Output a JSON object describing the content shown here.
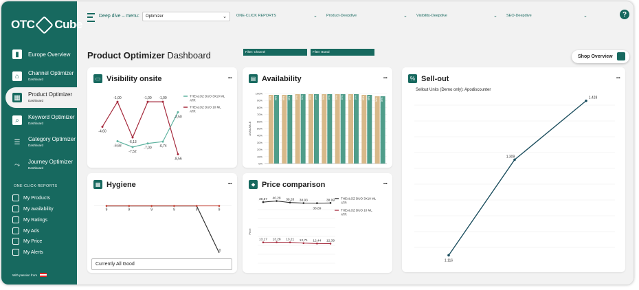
{
  "logo": {
    "left": "OTC",
    "right": "Cube"
  },
  "nav": [
    {
      "label": "Europe Overview",
      "sub": ""
    },
    {
      "label": "Channel Optimizer",
      "sub": "Dashboard"
    },
    {
      "label": "Product Optimizer",
      "sub": "Dashboard"
    },
    {
      "label": "Keyword Optimizer",
      "sub": "Dashboard"
    },
    {
      "label": "Category Optimizer",
      "sub": "Dashboard"
    },
    {
      "label": "Journey Optimizer",
      "sub": "Dashboard"
    }
  ],
  "reports_title": "ONE-CLICK-REPORTS",
  "reports": [
    "My Products",
    "My availability",
    "My Ratings",
    "My Ads",
    "My Price",
    "My Alerts"
  ],
  "footer": "With passion from",
  "topbar": {
    "deep_dive_label": "Deep dive – menu:",
    "selected": "Optimizer",
    "tabs": [
      "ONE-CLICK REPORTS",
      "Product-Deepdive",
      "Visibility-Deepdive",
      "SEO-Deepdive"
    ]
  },
  "page": {
    "title_bold": "Product Optimizer",
    "title_rest": "Dashboard",
    "filters": [
      "Filter: Channel",
      "Filter: Brand"
    ],
    "shop_button": "Shop Overview"
  },
  "cards": {
    "visibility": {
      "title": "Visibility onsite",
      "menu": "..."
    },
    "availability": {
      "title": "Availability",
      "menu": "..."
    },
    "sellout": {
      "title": "Sell-out",
      "menu": "...",
      "subtitle": "Sellout Units (Demo only): Apodiscounter"
    },
    "hygiene": {
      "title": "Hygiene",
      "menu": "...",
      "status": "Currently All Good"
    },
    "price": {
      "title": "Price comparison",
      "menu": "..."
    }
  },
  "colors": {
    "brand": "#17695f",
    "teal_series": "#5fb3a0",
    "red_series": "#a52a3c",
    "tan_bar": "#d8b98a",
    "green_bar": "#4f9d8a"
  },
  "chart_data": [
    {
      "id": "visibility",
      "type": "line",
      "x_count": 6,
      "series": [
        {
          "name": "THEALOZ DUO 3X10 ML ATR",
          "values": [
            null,
            -6.68,
            -7.52,
            -7.0,
            -6.74,
            -2.5
          ],
          "labels": [
            "",
            "-6,68",
            "-7,52",
            "-7,00",
            "-6,74",
            "-2,50"
          ]
        },
        {
          "name": "THEALOZ DUO 10 ML ATR",
          "values": [
            -4.6,
            -1.0,
            -6.13,
            -1.0,
            -1.0,
            -8.56
          ],
          "labels": [
            "-4,60",
            "-1,00",
            "-6,13",
            "-1,00",
            "-1,00",
            "-8,56"
          ]
        }
      ],
      "ylim": [
        -9.5,
        0
      ]
    },
    {
      "id": "availability",
      "type": "bar",
      "ylabel": "AVAILABLE",
      "yticks": [
        "100%",
        "90%",
        "80%",
        "70%",
        "60%",
        "50%",
        "40%",
        "30%",
        "20%",
        "10%",
        "0%"
      ],
      "ylim": [
        0,
        100
      ],
      "series": [
        {
          "name": "tan",
          "values": [
            98,
            98,
            99,
            99,
            99,
            99,
            99,
            98,
            96
          ]
        },
        {
          "name": "green",
          "values": [
            98,
            98,
            99,
            99,
            99,
            99,
            99,
            98,
            96
          ]
        }
      ],
      "bar_labels": [
        "98%",
        "98%",
        "99%",
        "99%",
        "99%",
        "99%",
        "99%",
        "98%",
        "96%"
      ]
    },
    {
      "id": "sellout",
      "type": "line",
      "values": [
        1116,
        1309,
        1428
      ],
      "labels": [
        "1.116",
        "1.309",
        "1.428"
      ],
      "ylim": [
        1100,
        1440
      ]
    },
    {
      "id": "hygiene",
      "type": "line",
      "series": [
        {
          "name": "red",
          "values": [
            9,
            9,
            9,
            9,
            9,
            9
          ]
        },
        {
          "name": "dark",
          "values": [
            9,
            9,
            9,
            9,
            9,
            0
          ]
        }
      ],
      "labels": [
        "9",
        "9",
        "9",
        "9",
        "9",
        "9"
      ],
      "last_label": "0",
      "ylim": [
        0,
        10
      ]
    },
    {
      "id": "price",
      "type": "line",
      "ylabel": "Price",
      "series": [
        {
          "name": "THEALOZ DUO 3X10 ML ATR",
          "values": [
            39.57,
            40.28,
            39.28,
            38.93,
            38.89,
            38.99
          ],
          "labels": [
            "39,57",
            "40,28",
            "39,28",
            "38,93",
            "38,89",
            "38,99"
          ]
        },
        {
          "name": "THEALOZ DUO 10 ML ATR",
          "values": [
            13.17,
            13.28,
            13.21,
            12.71,
            12.44,
            12.39
          ],
          "labels": [
            "13,17",
            "13,28",
            "13,21",
            "12,71",
            "12,44",
            "12,39"
          ]
        }
      ],
      "ylim": [
        0,
        45
      ]
    }
  ]
}
